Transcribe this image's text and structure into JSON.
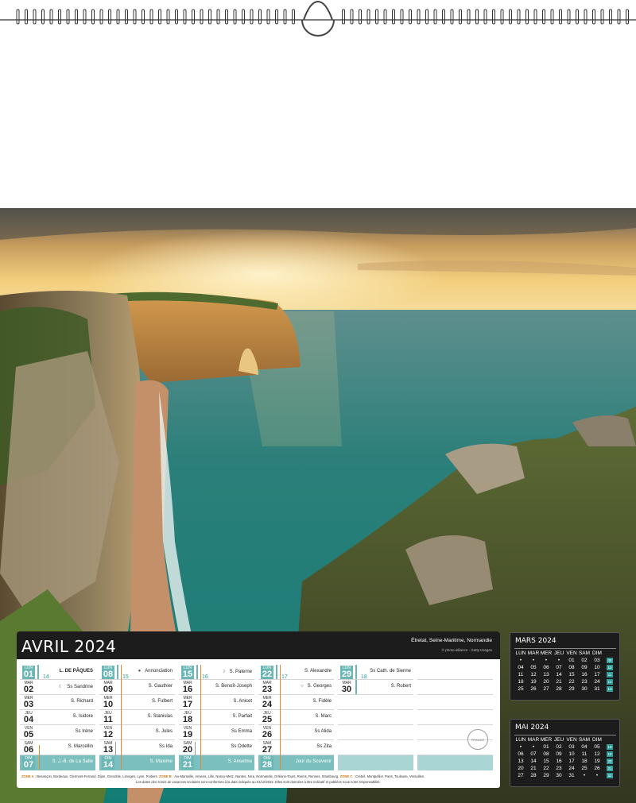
{
  "month": {
    "title": "AVRIL 2024",
    "caption": "Étretat, Seine-Maritime, Normandie",
    "credit": "© photo-alliance · Getty Images",
    "columns": [
      {
        "week": "14",
        "days": [
          {
            "dn": "LUN",
            "dd": "01",
            "name": "L. DE PÂQUES",
            "moon": ""
          },
          {
            "dn": "MAR",
            "dd": "02",
            "name": "Ss Sandrine",
            "moon": "☾"
          },
          {
            "dn": "MER",
            "dd": "03",
            "name": "S. Richard",
            "moon": ""
          },
          {
            "dn": "JEU",
            "dd": "04",
            "name": "S. Isidore",
            "moon": ""
          },
          {
            "dn": "VEN",
            "dd": "05",
            "name": "Ss Irène",
            "moon": ""
          },
          {
            "dn": "SAM",
            "dd": "06",
            "name": "S. Marcellin",
            "moon": ""
          },
          {
            "dn": "DIM",
            "dd": "07",
            "name": "S. J.-B. de La Salle",
            "moon": ""
          }
        ]
      },
      {
        "week": "15",
        "days": [
          {
            "dn": "LUN",
            "dd": "08",
            "name": "Annonciation",
            "moon": "●"
          },
          {
            "dn": "MAR",
            "dd": "09",
            "name": "S. Gauthier",
            "moon": ""
          },
          {
            "dn": "MER",
            "dd": "10",
            "name": "S. Fulbert",
            "moon": ""
          },
          {
            "dn": "JEU",
            "dd": "11",
            "name": "S. Stanislas",
            "moon": ""
          },
          {
            "dn": "VEN",
            "dd": "12",
            "name": "S. Jules",
            "moon": ""
          },
          {
            "dn": "SAM",
            "dd": "13",
            "name": "Ss Ida",
            "moon": ""
          },
          {
            "dn": "DIM",
            "dd": "14",
            "name": "S. Maxime",
            "moon": ""
          }
        ]
      },
      {
        "week": "16",
        "days": [
          {
            "dn": "LUN",
            "dd": "15",
            "name": "S. Paterne",
            "moon": "☽"
          },
          {
            "dn": "MAR",
            "dd": "16",
            "name": "S. Benoît-Joseph",
            "moon": ""
          },
          {
            "dn": "MER",
            "dd": "17",
            "name": "S. Anicet",
            "moon": ""
          },
          {
            "dn": "JEU",
            "dd": "18",
            "name": "S. Parfait",
            "moon": ""
          },
          {
            "dn": "VEN",
            "dd": "19",
            "name": "Ss Emma",
            "moon": ""
          },
          {
            "dn": "SAM",
            "dd": "20",
            "name": "Ss Odette",
            "moon": ""
          },
          {
            "dn": "DIM",
            "dd": "21",
            "name": "S. Anselme",
            "moon": ""
          }
        ]
      },
      {
        "week": "17",
        "days": [
          {
            "dn": "LUN",
            "dd": "22",
            "name": "S. Alexandre",
            "moon": ""
          },
          {
            "dn": "MAR",
            "dd": "23",
            "name": "S. Georges",
            "moon": "○"
          },
          {
            "dn": "MER",
            "dd": "24",
            "name": "S. Fidèle",
            "moon": ""
          },
          {
            "dn": "JEU",
            "dd": "25",
            "name": "S. Marc",
            "moon": ""
          },
          {
            "dn": "VEN",
            "dd": "26",
            "name": "Ss Alida",
            "moon": ""
          },
          {
            "dn": "SAM",
            "dd": "27",
            "name": "Ss Zita",
            "moon": ""
          },
          {
            "dn": "DIM",
            "dd": "28",
            "name": "Jour du Souvenir",
            "moon": ""
          }
        ]
      },
      {
        "week": "18",
        "days": [
          {
            "dn": "LUN",
            "dd": "29",
            "name": "Ss Cath. de Sienne",
            "moon": ""
          },
          {
            "dn": "MAR",
            "dd": "30",
            "name": "S. Robert",
            "moon": ""
          }
        ]
      }
    ],
    "stamp": "FRANCE",
    "zones_line1": [
      {
        "label": "ZONE A :",
        "text": "Besançon, Bordeaux, Clermont-Ferrand, Dijon, Grenoble, Limoges, Lyon, Poitiers."
      },
      {
        "label": "ZONE B :",
        "text": "Aix-Marseille, Amiens, Lille, Nancy-Metz, Nantes, Nice, Normandie, Orléans-Tours, Reims, Rennes, Strasbourg."
      },
      {
        "label": "ZONE C :",
        "text": "Créteil, Montpellier, Paris, Toulouse, Versailles."
      }
    ],
    "zones_note": "Les dates des zones de vacances scolaires sont conformes à la date indiquée au 01/12/2022. Elles sont données à titre indicatif et publiées sous notre responsabilité."
  },
  "minis": [
    {
      "title": "MARS 2024",
      "headers": [
        "LUN",
        "MAR",
        "MER",
        "JEU",
        "VEN",
        "SAM",
        "DIM"
      ],
      "rows": [
        {
          "cells": [
            "•",
            "•",
            "•",
            "•",
            "01",
            "02",
            "03"
          ],
          "week": "09"
        },
        {
          "cells": [
            "04",
            "05",
            "06",
            "07",
            "08",
            "09",
            "10"
          ],
          "week": "10"
        },
        {
          "cells": [
            "11",
            "12",
            "13",
            "14",
            "15",
            "16",
            "17"
          ],
          "week": "11"
        },
        {
          "cells": [
            "18",
            "19",
            "20",
            "21",
            "22",
            "23",
            "24"
          ],
          "week": "12"
        },
        {
          "cells": [
            "25",
            "26",
            "27",
            "28",
            "29",
            "30",
            "31"
          ],
          "week": "13"
        }
      ]
    },
    {
      "title": "MAI 2024",
      "headers": [
        "LUN",
        "MAR",
        "MER",
        "JEU",
        "VEN",
        "SAM",
        "DIM"
      ],
      "rows": [
        {
          "cells": [
            "•",
            "•",
            "01",
            "02",
            "03",
            "04",
            "05"
          ],
          "week": "18"
        },
        {
          "cells": [
            "06",
            "07",
            "08",
            "09",
            "10",
            "11",
            "12"
          ],
          "week": "19"
        },
        {
          "cells": [
            "13",
            "14",
            "15",
            "16",
            "17",
            "18",
            "19"
          ],
          "week": "20"
        },
        {
          "cells": [
            "20",
            "21",
            "22",
            "23",
            "24",
            "25",
            "26"
          ],
          "week": "21"
        },
        {
          "cells": [
            "27",
            "28",
            "29",
            "30",
            "31",
            "•",
            "•"
          ],
          "week": "22"
        }
      ]
    }
  ]
}
